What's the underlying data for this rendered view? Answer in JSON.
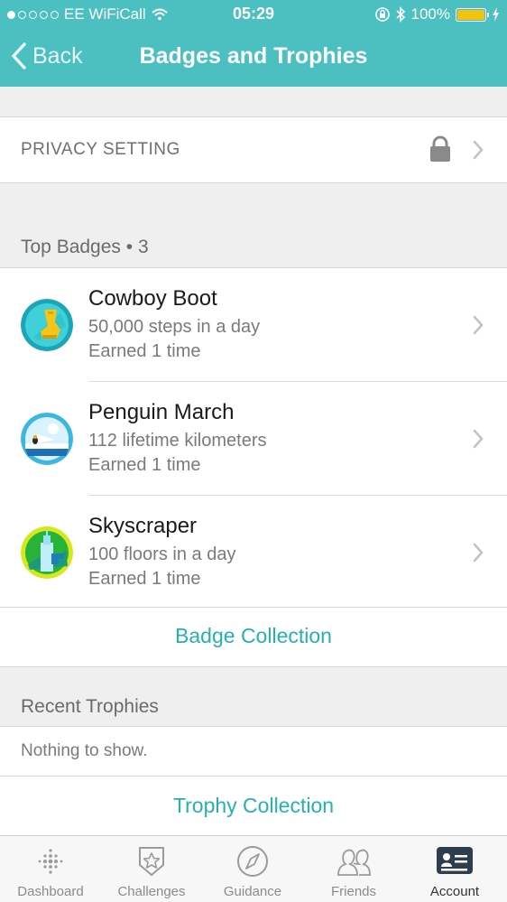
{
  "status_bar": {
    "carrier": "EE WiFiCall",
    "time": "05:29",
    "battery": "100%"
  },
  "nav": {
    "back_label": "Back",
    "title": "Badges and Trophies"
  },
  "privacy": {
    "label": "PRIVACY SETTING"
  },
  "top_badges": {
    "header": "Top Badges • 3",
    "items": [
      {
        "name": "Cowboy Boot",
        "description": "50,000 steps in a day",
        "earned": "Earned 1 time",
        "icon": "cowboy-boot-badge-icon"
      },
      {
        "name": "Penguin March",
        "description": "112 lifetime kilometers",
        "earned": "Earned 1 time",
        "icon": "penguin-march-badge-icon"
      },
      {
        "name": "Skyscraper",
        "description": "100 floors in a day",
        "earned": "Earned 1 time",
        "icon": "skyscraper-badge-icon"
      }
    ],
    "collection_link": "Badge Collection"
  },
  "recent_trophies": {
    "header": "Recent Trophies",
    "empty_text": "Nothing to show.",
    "collection_link": "Trophy Collection"
  },
  "tabbar": {
    "tabs": [
      {
        "label": "Dashboard",
        "icon": "dashboard-icon"
      },
      {
        "label": "Challenges",
        "icon": "challenges-icon"
      },
      {
        "label": "Guidance",
        "icon": "compass-icon"
      },
      {
        "label": "Friends",
        "icon": "friends-icon"
      },
      {
        "label": "Account",
        "icon": "account-card-icon"
      }
    ],
    "active": "Account"
  },
  "colors": {
    "header": "#4cc0c0",
    "link": "#27b0b0",
    "battery": "#f2c40f"
  }
}
